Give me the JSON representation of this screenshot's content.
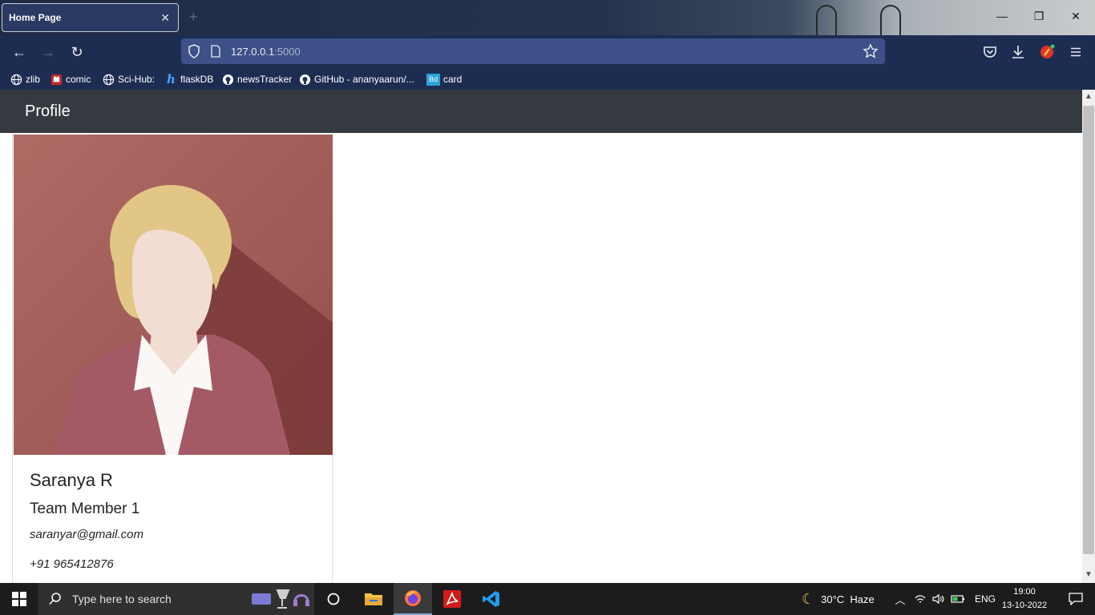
{
  "browser": {
    "tab_title": "Home Page",
    "url_host": "127.0.0.1",
    "url_port": ":5000"
  },
  "bookmarks": [
    {
      "label": "zlib",
      "icon": "globe-icon"
    },
    {
      "label": "comic",
      "icon": "comic-icon"
    },
    {
      "label": "Sci-Hub:",
      "icon": "globe-icon"
    },
    {
      "label": "flaskDB",
      "icon": "h-icon"
    },
    {
      "label": "newsTracker",
      "icon": "github-icon"
    },
    {
      "label": "GitHub - ananyaarun/...",
      "icon": "github-icon"
    },
    {
      "label": "card",
      "icon": "bd-icon"
    }
  ],
  "site": {
    "brand": "Profile"
  },
  "profile": {
    "name": "Saranya R",
    "role": "Team Member 1",
    "email": "saranyar@gmail.com",
    "phone": "+91 965412876"
  },
  "taskbar": {
    "search_placeholder": "Type here to search",
    "weather": "30°C  Haze",
    "language": "ENG",
    "time": "19:00",
    "date": "13-10-2022"
  },
  "colors": {
    "browser_frame": "#1d2d52",
    "url_bar": "#3d5188",
    "site_navbar": "#343a40",
    "avatar_background": "#a66560",
    "taskbar": "#1c1c1c"
  }
}
